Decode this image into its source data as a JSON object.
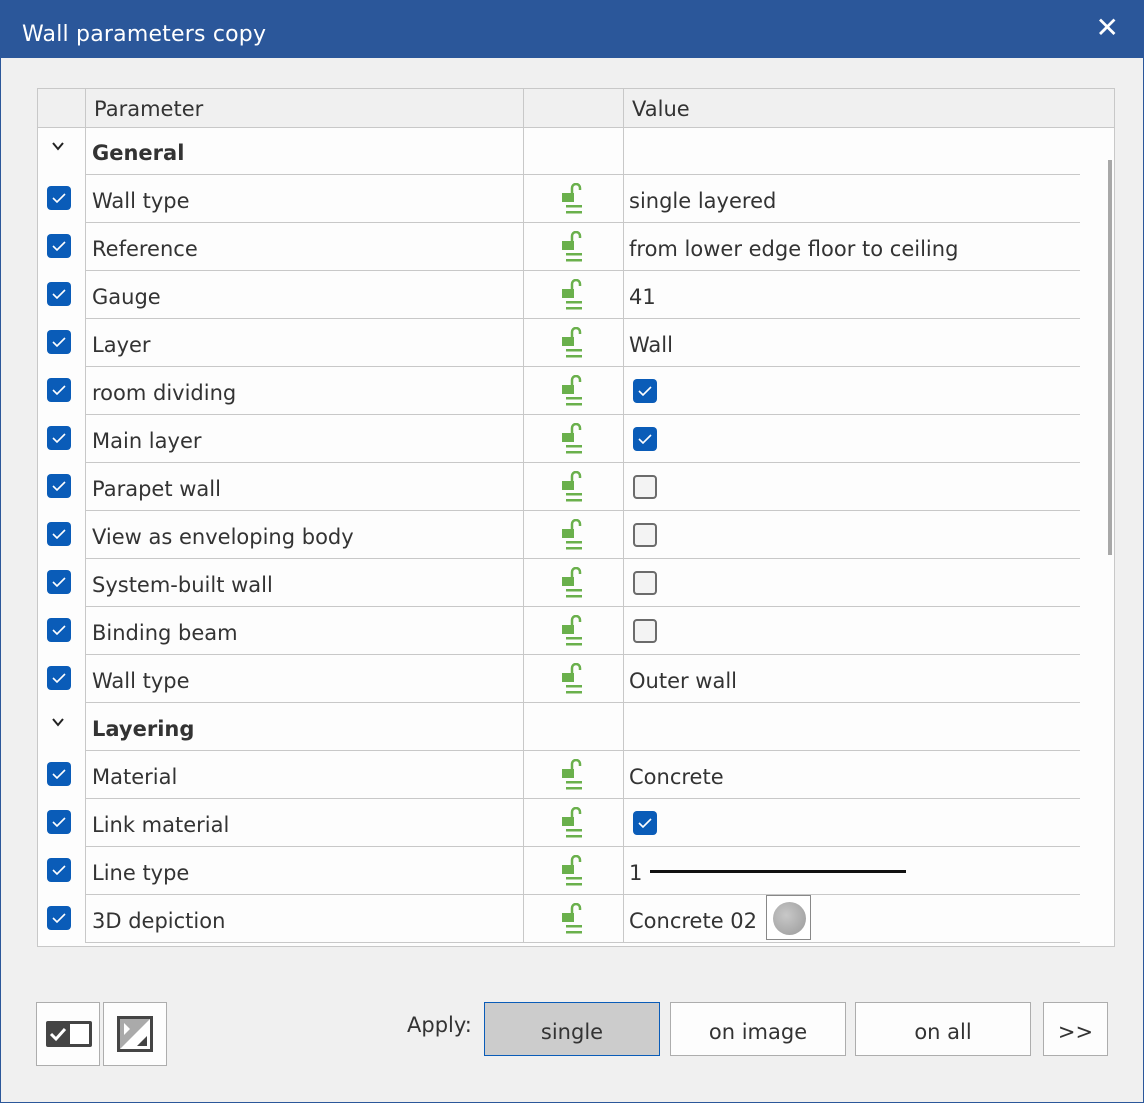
{
  "window": {
    "title": "Wall parameters copy",
    "close_icon": "close-icon"
  },
  "grid": {
    "columns": [
      "",
      "Parameter",
      "",
      "Value"
    ],
    "rows": [
      {
        "type": "group",
        "label": "General"
      },
      {
        "type": "param",
        "checked": true,
        "label": "Wall type",
        "value_type": "text",
        "value": "single layered"
      },
      {
        "type": "param",
        "checked": true,
        "label": "Reference",
        "value_type": "text",
        "value": "from lower edge floor to ceiling"
      },
      {
        "type": "param",
        "checked": true,
        "label": "Gauge",
        "value_type": "text",
        "value": "41"
      },
      {
        "type": "param",
        "checked": true,
        "label": "Layer",
        "value_type": "text",
        "value": "Wall"
      },
      {
        "type": "param",
        "checked": true,
        "label": "room dividing",
        "value_type": "checkbox",
        "value": true
      },
      {
        "type": "param",
        "checked": true,
        "label": "Main layer",
        "value_type": "checkbox",
        "value": true
      },
      {
        "type": "param",
        "checked": true,
        "label": "Parapet wall",
        "value_type": "checkbox",
        "value": false
      },
      {
        "type": "param",
        "checked": true,
        "label": "View as enveloping body",
        "value_type": "checkbox",
        "value": false
      },
      {
        "type": "param",
        "checked": true,
        "label": "System-built wall",
        "value_type": "checkbox",
        "value": false
      },
      {
        "type": "param",
        "checked": true,
        "label": "Binding beam",
        "value_type": "checkbox",
        "value": false
      },
      {
        "type": "param",
        "checked": true,
        "label": "Wall type",
        "value_type": "text",
        "value": "Outer wall"
      },
      {
        "type": "group",
        "label": "Layering"
      },
      {
        "type": "param",
        "checked": true,
        "label": "Material",
        "value_type": "text",
        "value": "Concrete"
      },
      {
        "type": "param",
        "checked": true,
        "label": "Link material",
        "value_type": "checkbox",
        "value": true
      },
      {
        "type": "param",
        "checked": true,
        "label": "Line type",
        "value_type": "line",
        "value": "1"
      },
      {
        "type": "param",
        "checked": true,
        "label": "3D depiction",
        "value_type": "texture",
        "value": "Concrete 02"
      }
    ]
  },
  "footer": {
    "apply_label": "Apply:",
    "buttons": {
      "single": "single",
      "on_image": "on image",
      "on_all": "on all",
      "more": ">>"
    },
    "active_button": "single"
  },
  "colors": {
    "titlebar": "#2b579a",
    "checkbox": "#0a5cb8",
    "lock": "#6ab04c"
  }
}
